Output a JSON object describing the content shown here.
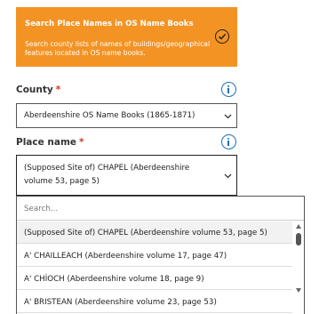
{
  "banner": {
    "title": "Search Place Names in OS Name Books",
    "description": "Search county lists of names of buildings/geographical features located in OS name books.",
    "status_icon": "check-circle-icon"
  },
  "county": {
    "label": "County",
    "required_marker": "*",
    "info_icon": "info-icon",
    "selected": "Aberdeenshire OS Name Books (1865-1871)"
  },
  "place": {
    "label": "Place name",
    "required_marker": "*",
    "info_icon": "info-icon",
    "selected": "(Supposed Site of) CHAPEL (Aberdeenshire volume 53, page 5)"
  },
  "dropdown": {
    "search_placeholder": "Search...",
    "options": [
      "(Supposed Site of) CHAPEL (Aberdeenshire volume 53, page 5)",
      "A' CHAILLEACH (Aberdeenshire volume 17, page 47)",
      "A' CHÌOCH (Aberdeenshire volume 18, page 9)",
      "A' BRISTEAN (Aberdeenshire volume 23, page 53)"
    ]
  },
  "colors": {
    "banner": "#f39324",
    "info_blue": "#1d70b8",
    "required_red": "#d4351c"
  }
}
